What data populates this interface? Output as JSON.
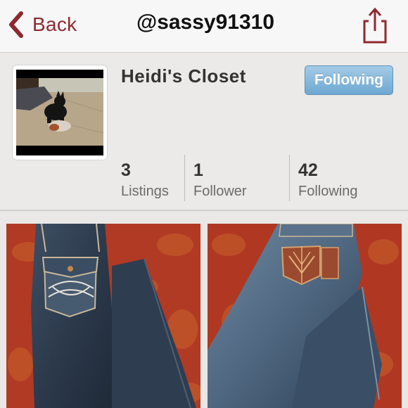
{
  "nav": {
    "back_label": "Back",
    "title": "@sassy91310"
  },
  "profile": {
    "closet_name": "Heidi's Closet",
    "follow_button_label": "Following",
    "stats": [
      {
        "value": "3",
        "label": "Listings"
      },
      {
        "value": "1",
        "label": "Follower"
      },
      {
        "value": "42",
        "label": "Following"
      }
    ]
  },
  "colors": {
    "accent": "#8e2a2f",
    "follow_button": "#7fb4da"
  },
  "icons": {
    "back": "chevron-left-icon",
    "share": "share-icon"
  }
}
